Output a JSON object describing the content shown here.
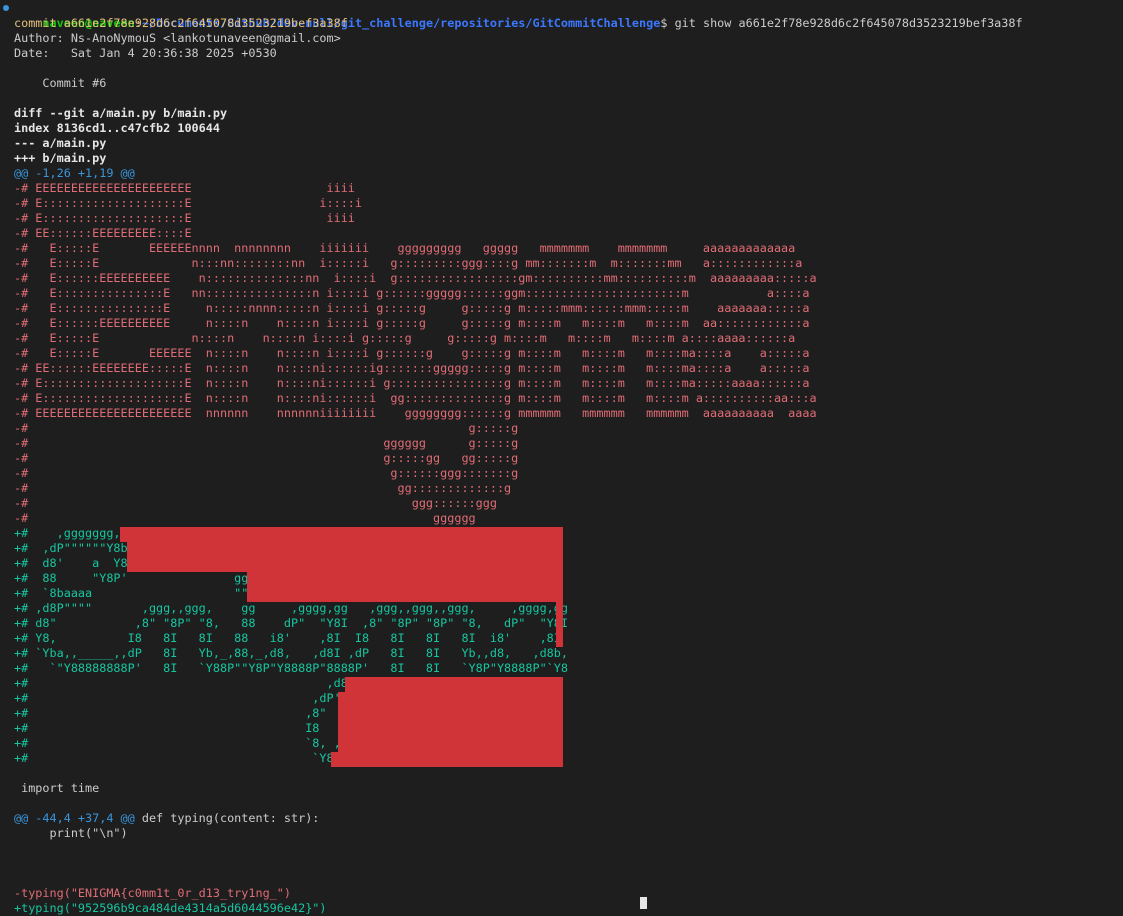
{
  "colors": {
    "background": "#1e1e1e",
    "default": "#cccccc",
    "prompt_user": "#16c60c",
    "prompt_path": "#3b78ff",
    "commit_hash": "#e5c07b",
    "meta": "#cccccc",
    "diff_header": "#e6e6e6",
    "hunk": "#3a96dd",
    "removed": "#e06c75",
    "added": "#16c6a0",
    "redaction": "#d13438"
  },
  "prompt": {
    "user": "naveen@naveen",
    "path": "~/Documents/Github/dev-null/git_challenge/repositories/GitCommitChallenge",
    "symbol": "$",
    "command": " git show a661e2f78e928d6c2f645078d3523219bef3a38f"
  },
  "lines": [
    {
      "type": "commit",
      "text": "commit a661e2f78e928d6c2f645078d3523219bef3a38f"
    },
    {
      "type": "meta",
      "text": "Author: Ns-AnoNymouS <lankotunaveen@gmail.com>"
    },
    {
      "type": "meta",
      "text": "Date:   Sat Jan 4 20:36:38 2025 +0530"
    },
    {
      "type": "meta",
      "text": ""
    },
    {
      "type": "meta",
      "text": "    Commit #6"
    },
    {
      "type": "meta",
      "text": ""
    },
    {
      "type": "diffhdr",
      "text": "diff --git a/main.py b/main.py"
    },
    {
      "type": "diffhdr",
      "text": "index 8136cd1..c47cfb2 100644"
    },
    {
      "type": "diffhdr",
      "text": "--- a/main.py"
    },
    {
      "type": "diffhdr",
      "text": "+++ b/main.py"
    },
    {
      "type": "hunk",
      "text": "@@ -1,26 +1,19 @@"
    },
    {
      "type": "removed",
      "text": "-# EEEEEEEEEEEEEEEEEEEEEE                   iiii"
    },
    {
      "type": "removed",
      "text": "-# E::::::::::::::::::::E                  i::::i"
    },
    {
      "type": "removed",
      "text": "-# E::::::::::::::::::::E                   iiii"
    },
    {
      "type": "removed",
      "text": "-# EE::::::EEEEEEEEE::::E"
    },
    {
      "type": "removed",
      "text": "-#   E:::::E       EEEEEEnnnn  nnnnnnnn    iiiiiii    ggggggggg   ggggg   mmmmmmm    mmmmmmm     aaaaaaaaaaaaa"
    },
    {
      "type": "removed",
      "text": "-#   E:::::E             n:::nn::::::::nn  i:::::i   g:::::::::ggg::::g mm:::::::m  m:::::::mm   a::::::::::::a"
    },
    {
      "type": "removed",
      "text": "-#   E::::::EEEEEEEEEE    n::::::::::::::nn  i::::i  g:::::::::::::::::gm::::::::::mm::::::::::m  aaaaaaaaa:::::a"
    },
    {
      "type": "removed",
      "text": "-#   E:::::::::::::::E   nn:::::::::::::::n i::::i g::::::ggggg::::::ggm::::::::::::::::::::::m           a::::a"
    },
    {
      "type": "removed",
      "text": "-#   E:::::::::::::::E     n:::::nnnn:::::n i::::i g:::::g     g:::::g m:::::mmm::::::mmm:::::m    aaaaaaa:::::a"
    },
    {
      "type": "removed",
      "text": "-#   E::::::EEEEEEEEEE     n::::n    n::::n i::::i g:::::g     g:::::g m::::m   m::::m   m::::m  aa::::::::::::a"
    },
    {
      "type": "removed",
      "text": "-#   E:::::E             n::::n    n::::n i::::i g:::::g     g:::::g m::::m   m::::m   m::::m a::::aaaa::::::a"
    },
    {
      "type": "removed",
      "text": "-#   E:::::E       EEEEEE  n::::n    n::::n i::::i g::::::g    g:::::g m::::m   m::::m   m::::ma::::a    a:::::a"
    },
    {
      "type": "removed",
      "text": "-# EE::::::EEEEEEEE:::::E  n::::n    n::::ni::::::ig:::::::ggggg:::::g m::::m   m::::m   m::::ma::::a    a:::::a"
    },
    {
      "type": "removed",
      "text": "-# E::::::::::::::::::::E  n::::n    n::::ni::::::i g::::::::::::::::g m::::m   m::::m   m::::ma:::::aaaa::::::a"
    },
    {
      "type": "removed",
      "text": "-# E::::::::::::::::::::E  n::::n    n::::ni::::::i  gg::::::::::::::g m::::m   m::::m   m::::m a::::::::::aa:::a"
    },
    {
      "type": "removed",
      "text": "-# EEEEEEEEEEEEEEEEEEEEEE  nnnnnn    nnnnnniiiiiiii    gggggggg::::::g mmmmmm   mmmmmm   mmmmmm  aaaaaaaaaa  aaaa"
    },
    {
      "type": "removed",
      "text": "-#                                                              g:::::g"
    },
    {
      "type": "removed",
      "text": "-#                                                  gggggg      g:::::g"
    },
    {
      "type": "removed",
      "text": "-#                                                  g:::::gg   gg:::::g"
    },
    {
      "type": "removed",
      "text": "-#                                                   g::::::ggg:::::::g"
    },
    {
      "type": "removed",
      "text": "-#                                                    gg:::::::::::::g"
    },
    {
      "type": "removed",
      "text": "-#                                                      ggg::::::ggg"
    },
    {
      "type": "removed",
      "text": "-#                                                         gggggg"
    },
    {
      "type": "added",
      "text": "+#    ,ggggggg,"
    },
    {
      "type": "added",
      "text": "+#  ,dP\"\"\"\"\"\"Y8b"
    },
    {
      "type": "added",
      "text": "+#  d8'    a  Y8"
    },
    {
      "type": "added",
      "text": "+#  88     \"Y8P'               gg"
    },
    {
      "type": "added",
      "text": "+#  `8baaaa                    \"\""
    },
    {
      "type": "added",
      "text": "+# ,d8P\"\"\"\"       ,ggg,,ggg,    gg     ,gggg,gg   ,ggg,,ggg,,ggg,     ,gggg,gg"
    },
    {
      "type": "added",
      "text": "+# d8\"           ,8\" \"8P\" \"8,   88    dP\"  \"Y8I  ,8\" \"8P\" \"8P\" \"8,   dP\"  \"Y8I"
    },
    {
      "type": "added",
      "text": "+# Y8,          I8   8I   8I   88   i8'    ,8I  I8   8I   8I   8I  i8'    ,8I"
    },
    {
      "type": "added",
      "text": "+# `Yba,,_____,,dP   8I   Yb,_,88,_,d8,   ,d8I ,dP   8I   8I   Yb,,d8,   ,d8b,"
    },
    {
      "type": "added",
      "text": "+#   `\"Y88888888P'   8I   `Y88P\"\"Y8P\"Y8888P\"8888P'   8I   8I   `Y8P\"Y8888P\"`Y8"
    },
    {
      "type": "added",
      "text": "+#                                          ,d8I'"
    },
    {
      "type": "added",
      "text": "+#                                        ,dP'8I"
    },
    {
      "type": "added",
      "text": "+#                                       ,8\"  8I"
    },
    {
      "type": "added",
      "text": "+#                                       I8   8I"
    },
    {
      "type": "added",
      "text": "+#                                       `8, ,8I"
    },
    {
      "type": "added",
      "text": "+#                                        `Y8P\""
    },
    {
      "type": "meta",
      "text": ""
    },
    {
      "type": "meta",
      "text": " import time"
    },
    {
      "type": "meta",
      "text": ""
    },
    {
      "type": "hunkctx",
      "text": "@@ -44,4 +37,4 @@",
      "tail": " def typing(content: str):"
    },
    {
      "type": "meta",
      "text": "     print(\"\\n\")"
    },
    {
      "type": "meta",
      "text": ""
    },
    {
      "type": "meta",
      "text": ""
    },
    {
      "type": "meta",
      "text": ""
    },
    {
      "type": "removed",
      "text": "-typing(\"ENIGMA{c0mm1t_0r_d13_try1ng_\")"
    },
    {
      "type": "added",
      "text": "+typing(\"952596b9ca484de4314a5d6044596e42}\")"
    }
  ],
  "redactions": [
    {
      "row": 35
    },
    {
      "row": 36
    },
    {
      "row": 37
    },
    {
      "row": 38
    },
    {
      "row": 39
    },
    {
      "row": 40
    },
    {
      "row": 41
    },
    {
      "row": 42
    },
    {
      "row": 45
    },
    {
      "row": 46
    },
    {
      "row": 47
    },
    {
      "row": 48
    },
    {
      "row": 49
    },
    {
      "row": 50
    }
  ]
}
